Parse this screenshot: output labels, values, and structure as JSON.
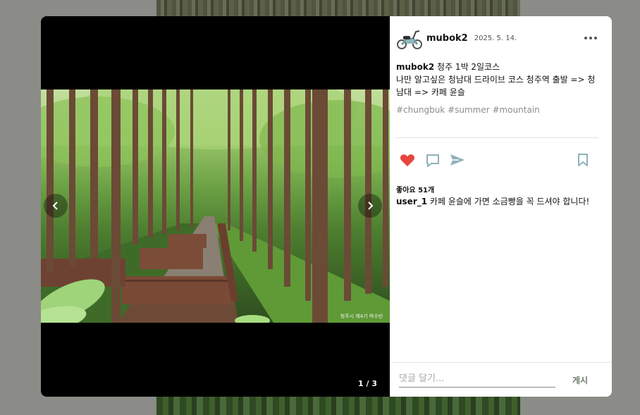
{
  "post": {
    "username": "mubok2",
    "date": "2025. 5. 14.",
    "caption_user": "mubok2",
    "caption_line1": " 청주 1박 2일코스",
    "caption_line2": "나만 알고싶은 청남대 드라이브 코스 청주역 출발 => 청남대 => 카페 윤슬",
    "tags": "#chungbuk #summer #mountain",
    "likes": "좋아요 51개",
    "comment_user": "user_1",
    "comment_text": " 카페 윤슬에 가면 소금빵을 꼭 드셔야 합니다!",
    "image_counter": "1 / 3",
    "photo_watermark": "청주시 제4기 박수빈"
  },
  "comment_bar": {
    "placeholder": "댓글 달기...",
    "post_label": "게시"
  },
  "icons": {
    "like": "heart-icon",
    "comment": "speech-bubble-icon",
    "share": "paper-plane-icon",
    "save": "bookmark-icon",
    "more": "more-dots-icon",
    "prev": "chevron-left-icon",
    "next": "chevron-right-icon"
  },
  "colors": {
    "like": "#e8453c",
    "action_icon": "#8fb1b8",
    "post_button": "#6b7c6b"
  }
}
